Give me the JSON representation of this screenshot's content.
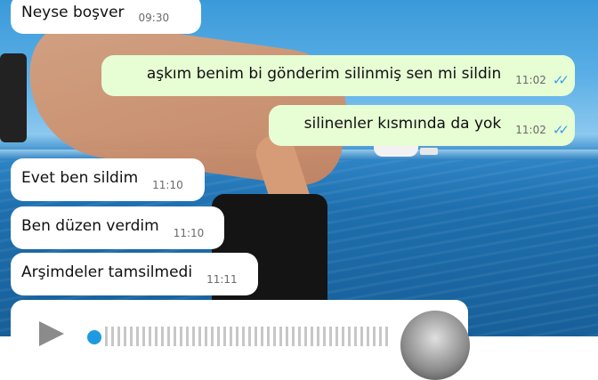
{
  "messages": [
    {
      "text": "Neyse boşver",
      "time": "09:30",
      "dir": "in"
    },
    {
      "text": "aşkım benim bi gönderim silinmiş sen mi sildin",
      "time": "11:02",
      "dir": "out"
    },
    {
      "text": "silinenler kısmında da yok",
      "time": "11:02",
      "dir": "out"
    },
    {
      "text": "Evet ben sildim",
      "time": "11:10",
      "dir": "in"
    },
    {
      "text": "Ben düzen verdim",
      "time": "11:10",
      "dir": "in"
    },
    {
      "text": "Arşimdeler tamsilmedi",
      "time": "11:11",
      "dir": "in"
    }
  ],
  "read_receipt_icon": "double-check-icon",
  "voice_message": {
    "play_icon": "play-icon"
  },
  "colors": {
    "incoming": "#ffffff",
    "outgoing": "#e7fdd4",
    "tick": "#3aa0e8"
  }
}
